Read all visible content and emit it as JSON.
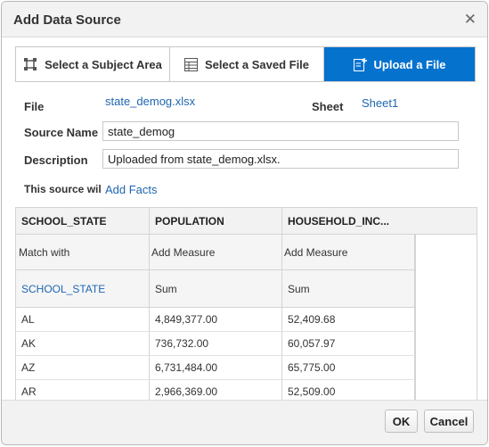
{
  "dialog": {
    "title": "Add Data Source",
    "close_icon": "close-icon"
  },
  "tabs": [
    {
      "label": "Select a Subject Area",
      "icon": "subject-area-icon",
      "active": false
    },
    {
      "label": "Select a Saved File",
      "icon": "saved-file-icon",
      "active": false
    },
    {
      "label": "Upload a File",
      "icon": "upload-file-icon",
      "active": true
    }
  ],
  "form": {
    "file_label": "File",
    "file_value": "state_demog.xlsx",
    "sheet_label": "Sheet",
    "sheet_value": "Sheet1",
    "source_name_label": "Source Name",
    "source_name_value": "state_demog",
    "description_label": "Description",
    "description_value": "Uploaded from state_demog.xlsx.",
    "source_will_label": "This source wil",
    "add_facts_link": "Add Facts"
  },
  "grid": {
    "columns": [
      "SCHOOL_STATE",
      "POPULATION",
      "HOUSEHOLD_INC..."
    ],
    "match_row": [
      "Match with",
      "Add Measure",
      "Add Measure"
    ],
    "agg_row": [
      "SCHOOL_STATE",
      "Sum",
      "Sum"
    ],
    "rows": [
      [
        "AL",
        "4,849,377.00",
        "52,409.68"
      ],
      [
        "AK",
        "736,732.00",
        "60,057.97"
      ],
      [
        "AZ",
        "6,731,484.00",
        "65,775.00"
      ],
      [
        "AR",
        "2,966,369.00",
        "52,509.00"
      ]
    ]
  },
  "footer": {
    "ok_label": "OK",
    "cancel_label": "Cancel"
  },
  "colors": {
    "accent": "#0572ce",
    "link": "#1f66b0",
    "header_bg": "#f2f2f2"
  }
}
